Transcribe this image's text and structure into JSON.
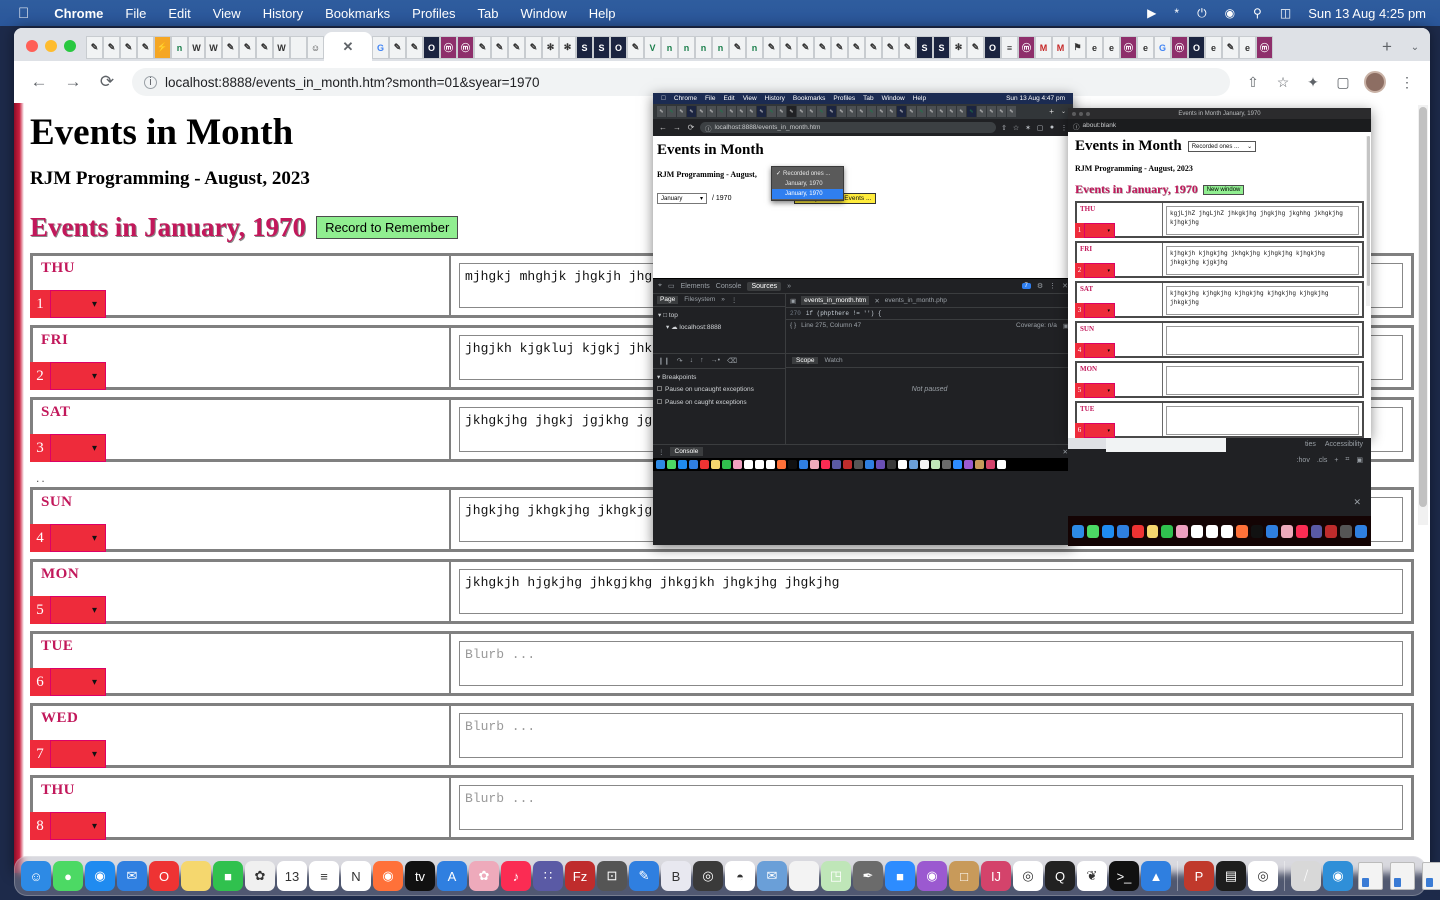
{
  "menubar": {
    "apple_icon": "apple-icon",
    "items": [
      "Chrome",
      "File",
      "Edit",
      "View",
      "History",
      "Bookmarks",
      "Profiles",
      "Tab",
      "Window",
      "Help"
    ],
    "status_icons": [
      "control-center-play-icon",
      "bluetooth-icon",
      "battery-charging-icon",
      "wifi-icon",
      "search-icon",
      "control-center-icon"
    ],
    "clock": "Sun 13 Aug  4:25 pm"
  },
  "browser": {
    "active_tab_close": "✕",
    "new_tab_label": "+",
    "tab_list_label": "⌄",
    "back_icon": "←",
    "forward_icon": "→",
    "reload_icon": "⟳",
    "info_icon": "ⓘ",
    "url": "localhost:8888/events_in_month.htm?smonth=01&syear=1970",
    "share_icon": "⇧",
    "bookmark_icon": "☆",
    "extensions_icon": "✦",
    "sidepanel_icon": "▢",
    "menu_icon": "⋮"
  },
  "page": {
    "title": "Events in Month",
    "subtitle": "RJM Programming - August, 2023",
    "month_heading": "Events in January, 1970",
    "record_button": "Record to Remember",
    "ellipsis_marker": "..",
    "textarea_placeholder": "Blurb ...",
    "select_caret": "⌄",
    "days": [
      {
        "dow": "THU",
        "num": "1",
        "text": "mjhgkj mhghjk jhgkjh jhgkjhg jhgkjhg jkghhg jkhgkjhg kjhgkjhg"
      },
      {
        "dow": "FRI",
        "num": "2",
        "text": "jhgjkh kjgkluj kjgkj jhkgkjhg kjhgkjhg kjhgkjhg jhkgkjhg"
      },
      {
        "dow": "SAT",
        "num": "3",
        "text": "jkhgkjhg jhgkj jgjkhg jghjkg kjhgkjhg kjhgkjhg jhkgkjhg"
      },
      {
        "dow": "SUN",
        "num": "4",
        "text": "jhgkjhg jkhgkjhg jkhgkjgh kjhgkjhg kjhgkjhg"
      },
      {
        "dow": "MON",
        "num": "5",
        "text": "jkhgkjh hjgkjhg jhkgjkhg jhkgjkh jhgkjhg jhgkjhg"
      },
      {
        "dow": "TUE",
        "num": "6",
        "text": ""
      },
      {
        "dow": "WED",
        "num": "7",
        "text": ""
      },
      {
        "dow": "THU",
        "num": "8",
        "text": ""
      }
    ]
  },
  "nested_devtools_window": {
    "menubar_items": [
      "Chrome",
      "File",
      "Edit",
      "View",
      "History",
      "Bookmarks",
      "Profiles",
      "Tab",
      "Window",
      "Help"
    ],
    "clock": "Sun 13 Aug 4:47 pm",
    "url": "localhost:8888/events_in_month.htm",
    "page_title": "Events in Month",
    "page_subtitle": "RJM Programming - August,",
    "select_value": "January",
    "year_text": "/ 1970",
    "yellow_button": "Ready to Fill in Events ...",
    "dropdown": {
      "options": [
        {
          "label": "Recorded ones ...",
          "checked": true,
          "selected": false
        },
        {
          "label": "January, 1970",
          "checked": false,
          "selected": false
        },
        {
          "label": "January, 1970",
          "checked": false,
          "selected": true
        }
      ]
    },
    "devtools": {
      "inspect_icon": "⌖",
      "device_icon": "▭",
      "tabs": [
        "Elements",
        "Console",
        "Sources"
      ],
      "active_tab": "Sources",
      "more_tabs": "»",
      "issues_count": "7",
      "settings_icon": "⚙",
      "kebab_icon": "⋮",
      "close_icon": "✕",
      "nav_tabs": [
        "Page",
        "Filesystem"
      ],
      "nav_more": "»",
      "nav_kebab": "⋮",
      "tree": [
        "top",
        "localhost:8888"
      ],
      "file_tabs": [
        "events_in_month.htm",
        "events_in_month.php"
      ],
      "file_tab_close": "✕",
      "code_line_no": "270",
      "code_text": "if (phpthere != '') {",
      "format_icon": "{ }",
      "cursor_pos": "Line 275, Column 47",
      "coverage": "Coverage: n/a",
      "panel_icon": "▣",
      "debug_icons": [
        "pause-icon",
        "step-over-icon",
        "step-into-icon",
        "step-out-icon",
        "step-icon",
        "deactivate-breakpoints-icon"
      ],
      "breakpoints_label": "Breakpoints",
      "bp_uncaught": "Pause on uncaught exceptions",
      "bp_caught": "Pause on caught exceptions",
      "scope_tabs": [
        "Scope",
        "Watch"
      ],
      "not_paused": "Not paused",
      "console_label": "Console",
      "console_close": "✕"
    }
  },
  "nested_white_window": {
    "title": "Events in Month January, 1970",
    "url": "about:blank",
    "info_icon": "ⓘ",
    "page_title": "Events in Month",
    "select_value": "Recorded ones ...",
    "select_caret": "⌄",
    "subtitle": "RJM Programming - August, 2023",
    "month_heading": "Events in January, 1970",
    "new_window_button": "New window",
    "days": [
      {
        "dow": "THU",
        "num": "1",
        "text": "kgjLjhZ jhgLjhZ jhkgkjhg jhgkjhg jkghhg jkhgkjhg kjhgkjhg"
      },
      {
        "dow": "FRI",
        "num": "2",
        "text": "kjhgkjh kjhgkjhg jkhgkjhg kjhgkjhg kjhgkjhg jhkgkjhg kjgkjhg"
      },
      {
        "dow": "SAT",
        "num": "3",
        "text": "kjhgkjhg kjhgkjhg kjhgkjhg kjhgkjhg kjhgkjhg jhkgkjhg"
      },
      {
        "dow": "SUN",
        "num": "4",
        "text": ""
      },
      {
        "dow": "MON",
        "num": "5",
        "text": ""
      },
      {
        "dow": "TUE",
        "num": "6",
        "text": ""
      }
    ],
    "devtools_fragment": {
      "tabs": [
        "ties",
        "Accessibility"
      ],
      "hov": ":hov",
      "cls": ".cls",
      "plus": "+",
      "brush_icon": "⌗",
      "panel_icon": "▣",
      "close_icon": "✕"
    }
  },
  "colors": {
    "menubar_blue": "#2f5d9e",
    "accent_pink": "#c2185b",
    "day_red": "#ee2b3b",
    "green_button": "#90ee90",
    "yellow_button": "#ffec3d",
    "devtools_bg": "#202124",
    "selected_blue": "#2f7ff0"
  }
}
